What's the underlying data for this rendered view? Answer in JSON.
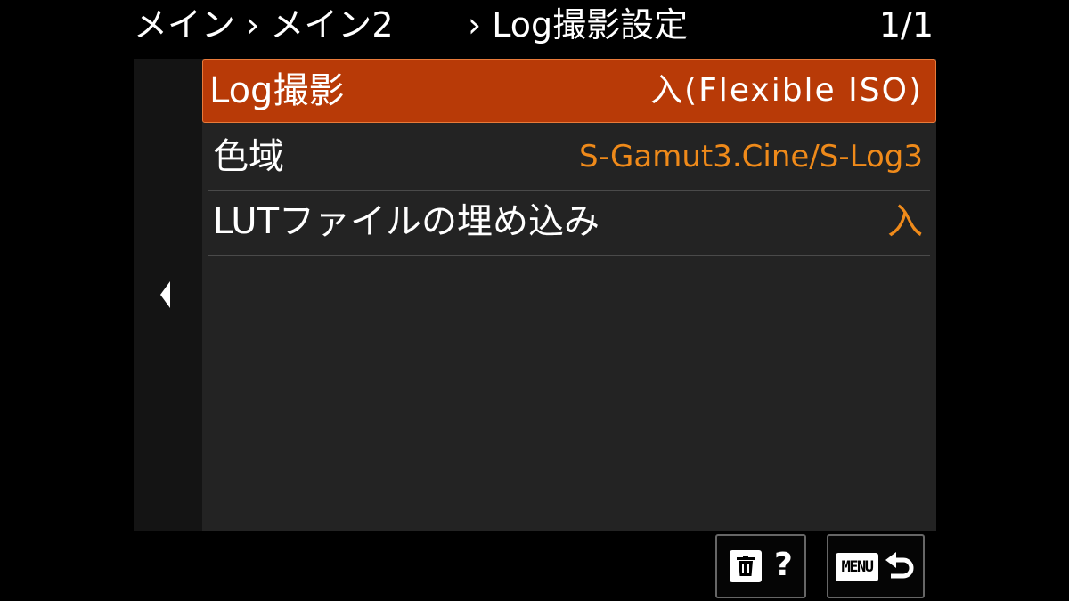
{
  "header": {
    "breadcrumb_left": "メイン › メイン2",
    "breadcrumb_current": "› Log撮影設定",
    "page": "1/1"
  },
  "menu": {
    "items": [
      {
        "label": "Log撮影",
        "value": "入(Flexible ISO)",
        "selected": true
      },
      {
        "label": "色域",
        "value": "S-Gamut3.Cine/S-Log3",
        "selected": false
      },
      {
        "label": "LUTファイルの埋め込み",
        "value": "入",
        "selected": false
      }
    ]
  },
  "footer": {
    "delete_help": {
      "icons": [
        "trash-icon",
        "question-mark-icon"
      ],
      "help_text": "?"
    },
    "menu_back": {
      "menu_text": "MENU",
      "icons": [
        "menu-icon",
        "return-icon"
      ]
    }
  },
  "colors": {
    "selected_bg": "#b83a07",
    "value_text": "#ef8a1a",
    "panel_bg": "#232323",
    "side_bg": "#141414"
  }
}
